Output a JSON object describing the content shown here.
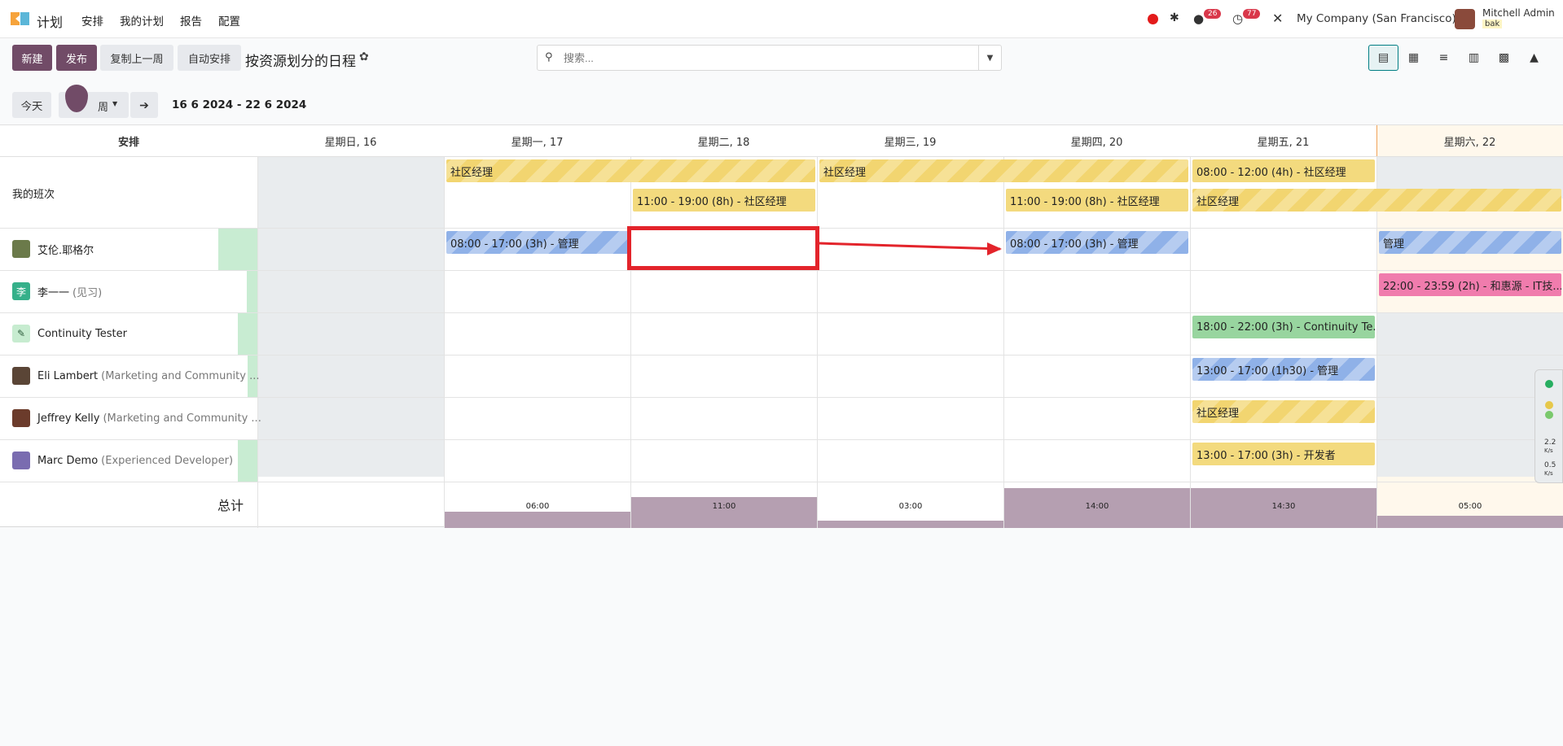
{
  "navbar": {
    "app_name": "计划",
    "menu": [
      "安排",
      "我的计划",
      "报告",
      "配置"
    ],
    "chat_count": "26",
    "activity_count": "77",
    "company": "My Company (San Francisco)",
    "user_name": "Mitchell Admin",
    "db_name": "bak"
  },
  "controls": {
    "new_label": "新建",
    "publish_label": "发布",
    "copy_prev_label": "复制上一周",
    "auto_plan_label": "自动安排",
    "title": "按资源划分的日程",
    "search_placeholder": "搜索..."
  },
  "date_nav": {
    "today_label": "今天",
    "scale_label": "周",
    "range": "16 6 2024 - 22 6 2024"
  },
  "gantt": {
    "group_header": "安排",
    "days": [
      "星期日, 16",
      "星期一, 17",
      "星期二, 18",
      "星期三, 19",
      "星期四, 20",
      "星期五, 21",
      "星期六, 22"
    ],
    "rows": [
      {
        "name": "我的班次",
        "sub": ""
      },
      {
        "name": "艾伦.耶格尔",
        "sub": ""
      },
      {
        "name": "李一一",
        "sub": "(见习)",
        "initial": "李"
      },
      {
        "name": "Continuity Tester",
        "sub": ""
      },
      {
        "name": "Eli Lambert",
        "sub": "(Marketing and Community ..."
      },
      {
        "name": "Jeffrey Kelly",
        "sub": "(Marketing and Community ..."
      },
      {
        "name": "Marc Demo",
        "sub": "(Experienced Developer)"
      }
    ],
    "shifts": {
      "s1": "社区经理",
      "s2": "社区经理",
      "s3": "08:00 - 12:00 (4h) - 社区经理",
      "s4": "11:00 - 19:00 (8h) - 社区经理",
      "s5": "11:00 - 19:00 (8h) - 社区经理",
      "s6": "社区经理",
      "s7": "08:00 - 17:00 (3h) - 管理",
      "s8": "08:00 - 17:00 (3h) - 管理",
      "s9": "管理",
      "s10": "22:00 - 23:59 (2h) - 和惠源 - IT技...",
      "s11": "18:00 - 22:00 (3h) - Continuity Te...",
      "s12": "13:00 - 17:00 (1h30) - 管理",
      "s13": "社区经理",
      "s14": "13:00 - 17:00 (3h) - 开发者"
    },
    "total_label": "总计",
    "totals": [
      "06:00",
      "11:00",
      "03:00",
      "14:00",
      "14:30",
      "05:00"
    ]
  },
  "widget": {
    "v1": "2.2",
    "u1": "K/s",
    "v2": "0.5",
    "u2": "K/s"
  },
  "colors": {
    "primary": "#714b67",
    "annotation": "#e3242b"
  }
}
